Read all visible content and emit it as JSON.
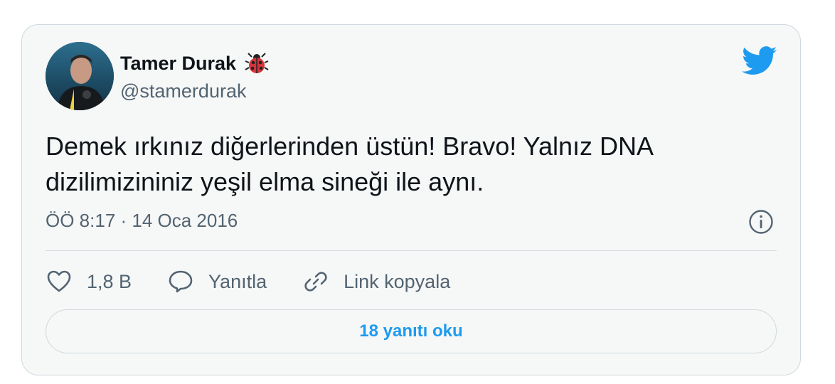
{
  "author": {
    "name": "Tamer Durak",
    "handle": "@stamerdurak",
    "name_emoji": "ladybug-icon"
  },
  "tweet": {
    "text_line1": "Demek ırkınız diğerlerinden üstün! Bravo! Yalnız DNA",
    "text_line2": "dizilimizininiz yeşil elma sineği ile aynı.",
    "timestamp": "ÖÖ 8:17 · 14 Oca 2016"
  },
  "actions": {
    "like_count": "1,8 B",
    "reply_label": "Yanıtla",
    "copy_link_label": "Link kopyala"
  },
  "replies_button": "18 yanıtı oku",
  "colors": {
    "brand": "#1d9bf0",
    "text": "#0f1419",
    "secondary_text": "#536471",
    "card_background": "#f6f7f7",
    "border": "#cfd9de"
  },
  "icons": [
    "twitter-bird-icon",
    "info-icon",
    "heart-icon",
    "speech-bubble-icon",
    "link-icon",
    "ladybug-icon"
  ]
}
